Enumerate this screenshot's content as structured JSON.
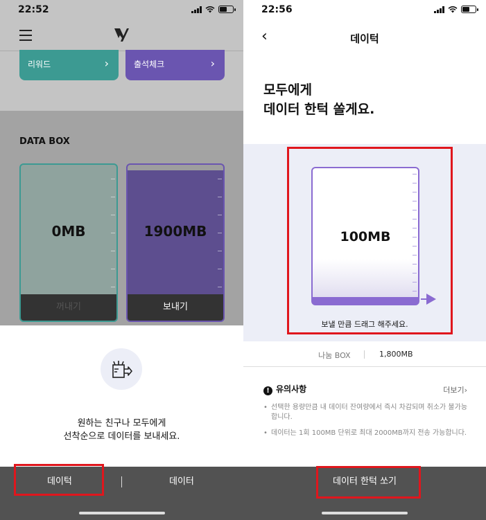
{
  "left": {
    "status_time": "22:52",
    "rewards": [
      {
        "label": "리워드"
      },
      {
        "label": "출석체크"
      }
    ],
    "databox_title": "DATA BOX",
    "receive_box": {
      "value": "0MB",
      "button": "꺼내기"
    },
    "send_box": {
      "value": "1900MB",
      "button": "보내기"
    },
    "sheet_message_line1": "원하는 친구나 모두에게",
    "sheet_message_line2": "선착순으로 데이터를 보내세요.",
    "bottom_tabs": [
      "데이턱",
      "데이터"
    ]
  },
  "right": {
    "status_time": "22:56",
    "title": "데이턱",
    "headline_line1": "모두에게",
    "headline_line2": "데이터 한턱 쏠게요.",
    "tank_value": "100MB",
    "drag_hint": "보낼 만큼 드래그 해주세요.",
    "share_box_label": "나눔 BOX",
    "share_box_amount": "1,800MB",
    "notice_title": "유의사항",
    "more_label": "더보기",
    "notices": [
      "선택한 용량만큼 내 데이터 잔여량에서 즉시 차감되며 취소가 불가능 합니다.",
      "데이터는 1회 100MB 단위로 최대 2000MB까지 전송 가능합니다."
    ],
    "send_button": "데이터 한턱 쏘기"
  },
  "colors": {
    "teal": "#3c9a92",
    "purple": "#6a55b0",
    "tank_purple": "#8a6bd1",
    "highlight_red": "#e0161d",
    "bottom_bar": "#525252"
  },
  "icons": [
    "hamburger-menu-icon",
    "brand-logo-icon",
    "chevron-right-icon",
    "send-box-icon",
    "back-arrow-icon",
    "warning-icon",
    "signal-icon",
    "wifi-icon",
    "battery-icon"
  ]
}
